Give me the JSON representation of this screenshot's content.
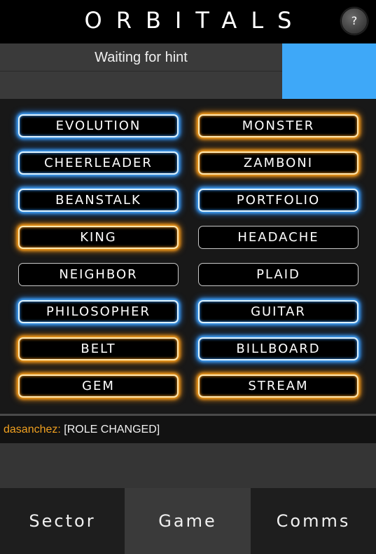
{
  "header": {
    "title": "ORBITALS",
    "help_label": "?"
  },
  "hint": {
    "status": "Waiting for hint"
  },
  "colors": {
    "blue_team": "#3ea8f8",
    "blue_glow": "#43a7ff",
    "orange_glow": "#ffa21a",
    "chat_user": "#f0a020"
  },
  "board": {
    "cards": [
      {
        "word": "EVOLUTION",
        "team": "blue"
      },
      {
        "word": "MONSTER",
        "team": "orange"
      },
      {
        "word": "CHEERLEADER",
        "team": "blue"
      },
      {
        "word": "ZAMBONI",
        "team": "orange"
      },
      {
        "word": "BEANSTALK",
        "team": "blue"
      },
      {
        "word": "PORTFOLIO",
        "team": "blue"
      },
      {
        "word": "KING",
        "team": "orange"
      },
      {
        "word": "HEADACHE",
        "team": "neutral"
      },
      {
        "word": "NEIGHBOR",
        "team": "neutral"
      },
      {
        "word": "PLAID",
        "team": "neutral"
      },
      {
        "word": "PHILOSOPHER",
        "team": "blue"
      },
      {
        "word": "GUITAR",
        "team": "blue"
      },
      {
        "word": "BELT",
        "team": "orange"
      },
      {
        "word": "BILLBOARD",
        "team": "blue"
      },
      {
        "word": "GEM",
        "team": "orange"
      },
      {
        "word": "STREAM",
        "team": "orange"
      }
    ]
  },
  "chat": {
    "user": "dasanchez:",
    "message": "[ROLE CHANGED]"
  },
  "tabs": [
    {
      "label": "Sector",
      "active": false
    },
    {
      "label": "Game",
      "active": true
    },
    {
      "label": "Comms",
      "active": false
    }
  ]
}
